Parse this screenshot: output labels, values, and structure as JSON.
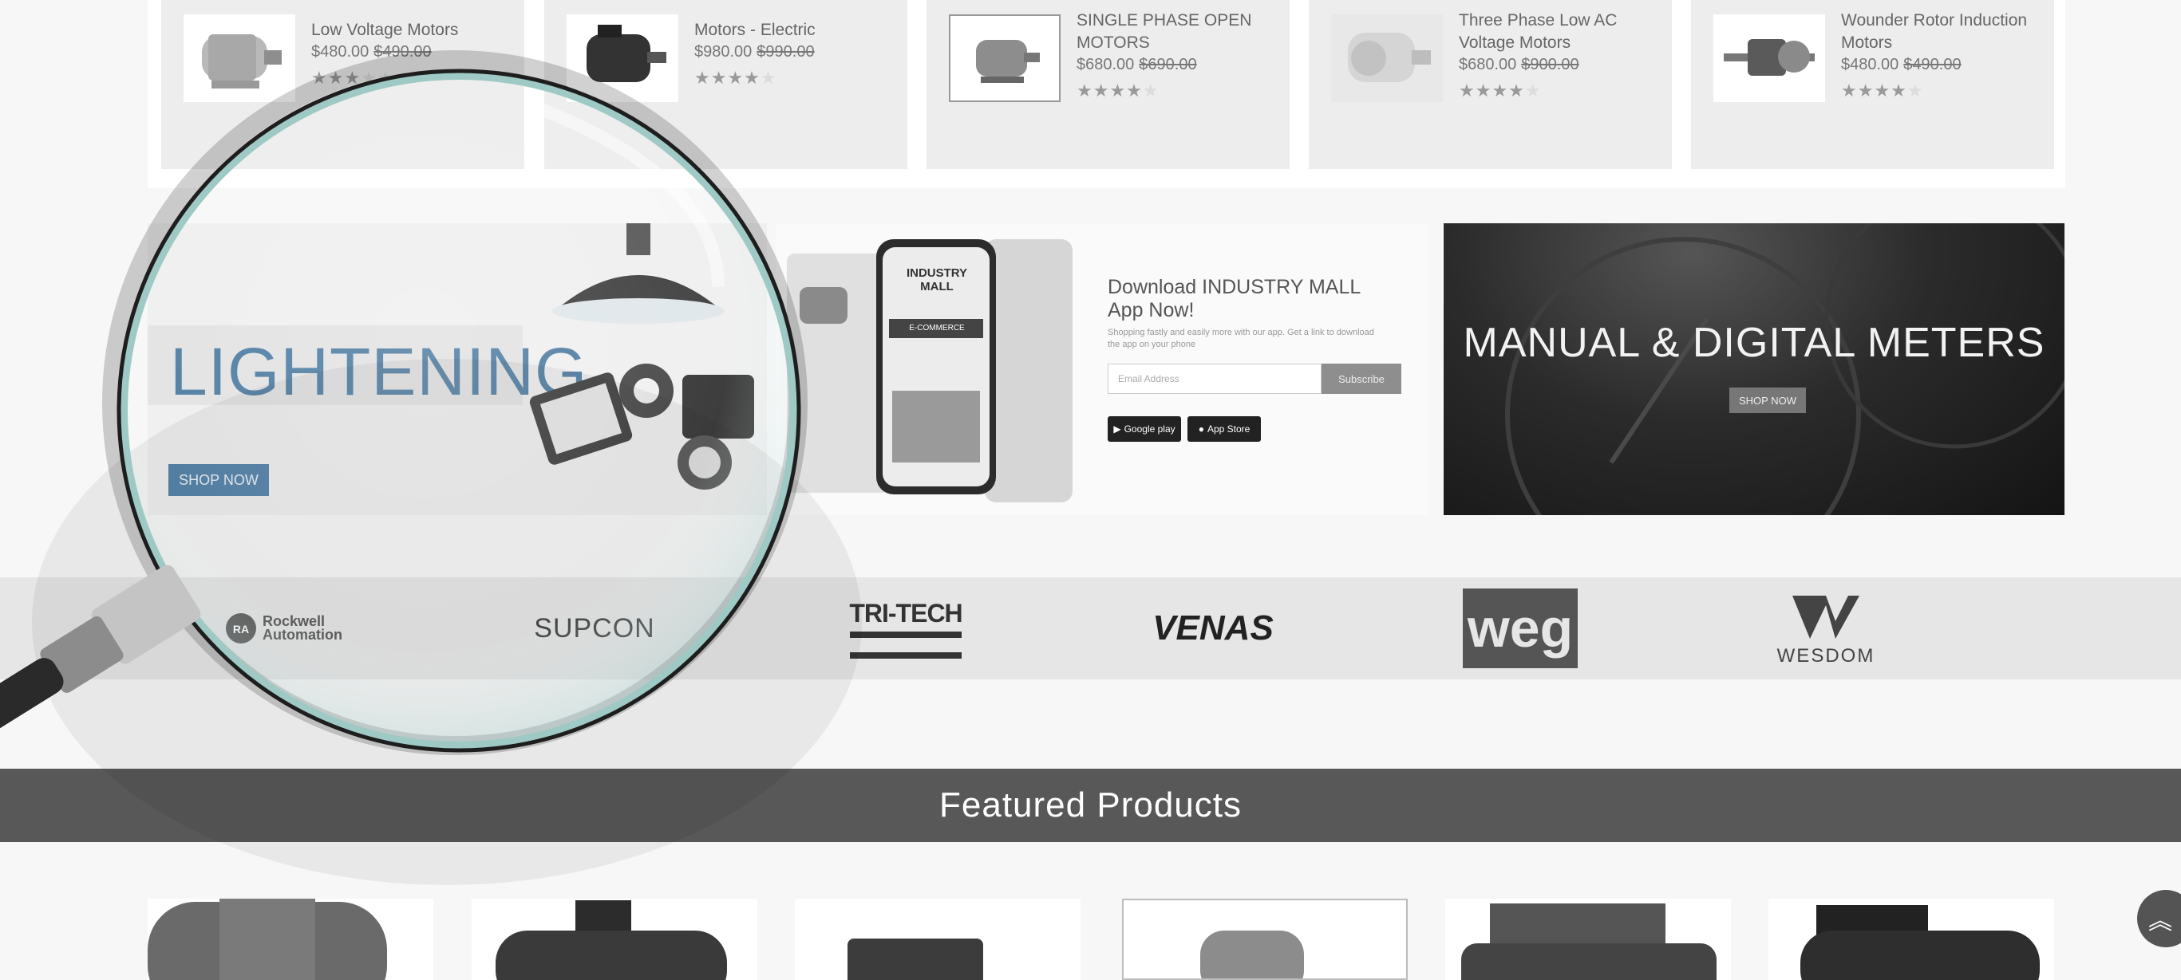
{
  "products": [
    {
      "name": "Low Voltage Motors",
      "price": "$480.00",
      "old_price": "$490.00",
      "rating": 3
    },
    {
      "name": "Motors - Electric",
      "price": "$980.00",
      "old_price": "$990.00",
      "rating": 4
    },
    {
      "name": "SINGLE PHASE OPEN MOTORS",
      "price": "$680.00",
      "old_price": "$690.00",
      "rating": 4
    },
    {
      "name": "Three Phase Low AC Voltage Motors",
      "price": "$680.00",
      "old_price": "$900.00",
      "rating": 4
    },
    {
      "name": "Wounder Rotor Induction Motors",
      "price": "$480.00",
      "old_price": "$490.00",
      "rating": 4
    }
  ],
  "banners": {
    "lighting": {
      "title": "LIGHTENING",
      "button": "SHOP NOW"
    },
    "app": {
      "phone_label": "INDUSTRY MALL",
      "phone_tag": "E-COMMERCE",
      "heading": "Download INDUSTRY MALL App Now!",
      "subtext": "Shopping fastly and easily more with our app. Get a link to download the app on your phone",
      "email_placeholder": "Email Address",
      "subscribe": "Subscribe",
      "google_play": "Google play",
      "app_store": "App Store"
    },
    "meters": {
      "title": "MANUAL & DIGITAL METERS",
      "button": "SHOP NOW"
    }
  },
  "brands": [
    "Rockwell Automation",
    "SUPCON",
    "TRI-TECH",
    "VENAS",
    "weg",
    "WESDOM"
  ],
  "featured": {
    "title": "Featured Products"
  },
  "colors": {
    "accent_blue": "#4d7ea6",
    "dark_band": "#585858",
    "light_bg": "#f7f7f7"
  },
  "icons": {
    "scroll_top": "double-chevron-up-icon"
  }
}
